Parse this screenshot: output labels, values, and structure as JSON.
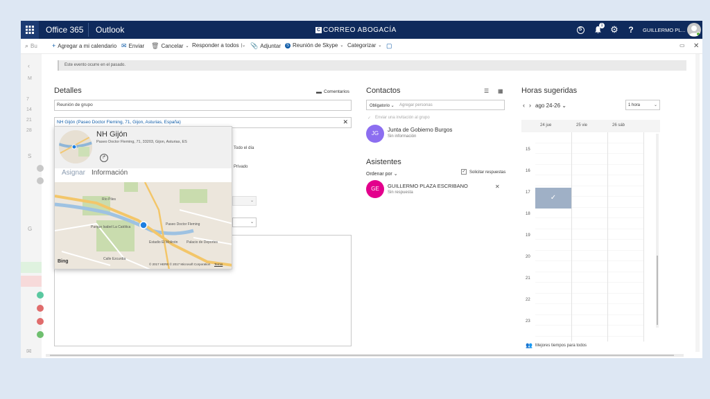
{
  "topbar": {
    "office": "Office 365",
    "app": "Outlook",
    "brand_prefix": "C",
    "brand": "CORREO ABOGACÍA",
    "notification_count": "1",
    "user": "GUILLERMO PL...",
    "help": "?"
  },
  "commands": {
    "search_placeholder": "Bu",
    "add_calendar": "Agregar a mi calendario",
    "send": "Enviar",
    "cancel": "Cancelar",
    "reply_all": "Responder a todos",
    "attach": "Adjuntar",
    "skype": "Reunión de Skype",
    "categorize": "Categorizar"
  },
  "left_strip": {
    "nums": [
      "7",
      "14",
      "21",
      "28"
    ],
    "letters": [
      "M",
      "S",
      "G"
    ]
  },
  "banner": "Este evento ocurre en el pasado.",
  "details": {
    "title": "Detalles",
    "comments": "Comentarios",
    "subject": "Reunión de grupo",
    "location": "NH Gijón (Paseo Doctor Fleming, 71, Gijon, Asturias, España)",
    "all_day": "Todo el día",
    "private": "Privado"
  },
  "location_card": {
    "name": "NH Gijón",
    "address": "Paseo Doctor Fleming, 71, 33203, Gijon, Asturias, ES",
    "tab_assign": "Asignar",
    "tab_info": "Información",
    "map_labels": [
      "Paseo Doctor Fleming",
      "El Molinón",
      "Río Piles",
      "Parque Isabel La Católica",
      "Estadio El Molinón",
      "Palacio de Deportes",
      "Calle Ezcurdia"
    ],
    "bing": "Bing",
    "copyright": "© 2017 HERE © 2017 Microsoft Corporation",
    "terms": "Terms"
  },
  "contacts": {
    "title": "Contactos",
    "required": "Obligatorio",
    "add_people_placeholder": "Agregar personas",
    "send_group_invite": "Enviar una invitación al grupo",
    "group": {
      "initials": "JG",
      "name": "Junta de Gobierno Burgos",
      "status": "Sin información",
      "color": "#8c6ef0"
    }
  },
  "attendees": {
    "title": "Asistentes",
    "sort": "Ordenar por",
    "request_responses": "Solicitar respuestas",
    "person": {
      "initials": "GE",
      "name": "GUILLERMO PLAZA ESCRIBANO",
      "status": "Sin respuesta",
      "color": "#e3008c"
    }
  },
  "suggested": {
    "title": "Horas sugeridas",
    "range": "ago 24-26",
    "duration": "1 hora",
    "days": [
      "24 jue",
      "25 vie",
      "26 sáb"
    ],
    "hours": [
      "15",
      "16",
      "17",
      "18",
      "19",
      "20",
      "21",
      "22",
      "23"
    ],
    "best_times": "Mejores tiempos para todos"
  },
  "colors": {
    "accent": "#0f2a5c",
    "selected_slot": "#9fb0c6"
  }
}
